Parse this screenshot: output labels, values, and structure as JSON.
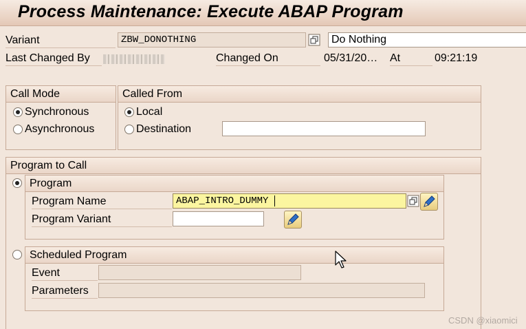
{
  "title": "Process Maintenance: Execute ABAP Program",
  "header": {
    "variant_label": "Variant",
    "variant_value": "ZBW_DONOTHING",
    "variant_description": "Do Nothing",
    "last_changed_by_label": "Last Changed By",
    "changed_on_label": "Changed On",
    "changed_on_value": "05/31/20…",
    "at_label": "At",
    "at_value": "09:21:19"
  },
  "call_mode": {
    "title": "Call Mode",
    "options": [
      "Synchronous",
      "Asynchronous"
    ],
    "selected": "Synchronous"
  },
  "called_from": {
    "title": "Called From",
    "options": [
      "Local",
      "Destination"
    ],
    "selected": "Local",
    "destination_value": ""
  },
  "program_to_call": {
    "title": "Program to Call",
    "program": {
      "title": "Program",
      "selected": true,
      "program_name_label": "Program Name",
      "program_name_value": "ABAP_INTRO_DUMMY",
      "program_variant_label": "Program Variant",
      "program_variant_value": ""
    },
    "scheduled": {
      "title": "Scheduled Program",
      "selected": false,
      "event_label": "Event",
      "event_value": "",
      "parameters_label": "Parameters",
      "parameters_value": ""
    }
  },
  "watermark": "CSDN @xiaomici",
  "icons": [
    "copy-icon",
    "pencil-icon",
    "mouse-cursor-icon"
  ]
}
